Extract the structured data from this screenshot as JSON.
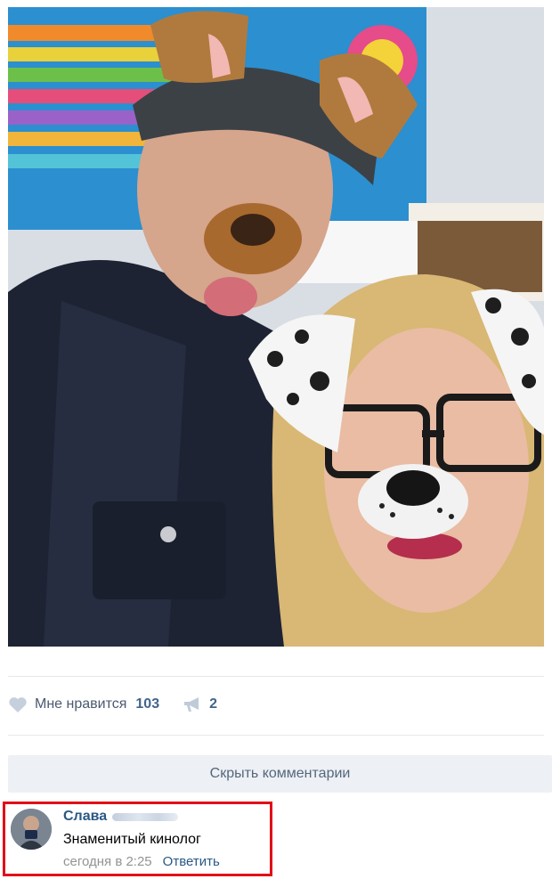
{
  "post": {
    "photo_alt": "",
    "likes": {
      "label": "Мне нравится",
      "count": "103"
    },
    "shares": {
      "count": "2"
    }
  },
  "comments": {
    "hide_label": "Скрыть комментарии",
    "items": [
      {
        "author": "Слава",
        "text": "Знаменитый кинолог",
        "time": "сегодня в 2:25",
        "reply_label": "Ответить"
      }
    ]
  },
  "colors": {
    "link": "#2a5885",
    "count": "#42648b",
    "muted": "#939393",
    "highlight": "#e10f17",
    "button_bg": "#edf0f4"
  },
  "icons": {
    "like": "heart-icon",
    "share": "megaphone-icon"
  }
}
